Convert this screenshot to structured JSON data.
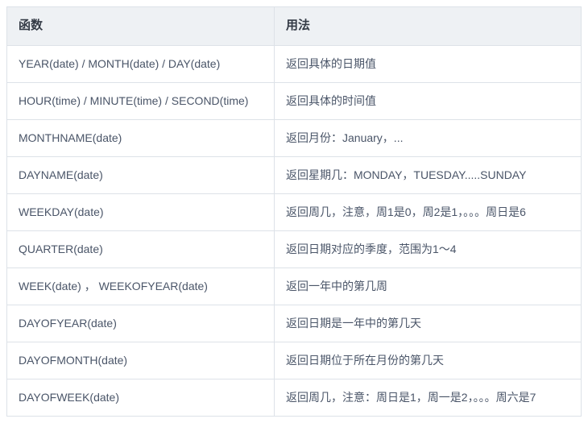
{
  "table": {
    "headers": [
      "函数",
      "用法"
    ],
    "rows": [
      {
        "fn": "YEAR(date) / MONTH(date) / DAY(date)",
        "usage": "返回具体的日期值"
      },
      {
        "fn": "HOUR(time) / MINUTE(time) / SECOND(time)",
        "usage": "返回具体的时间值"
      },
      {
        "fn": "MONTHNAME(date)",
        "usage": "返回月份：January，..."
      },
      {
        "fn": "DAYNAME(date)",
        "usage": "返回星期几：MONDAY，TUESDAY.....SUNDAY"
      },
      {
        "fn": "WEEKDAY(date)",
        "usage": "返回周几，注意，周1是0，周2是1，。。。周日是6"
      },
      {
        "fn": "QUARTER(date)",
        "usage": "返回日期对应的季度，范围为1～4"
      },
      {
        "fn": "WEEK(date) ， WEEKOFYEAR(date)",
        "usage": "返回一年中的第几周"
      },
      {
        "fn": "DAYOFYEAR(date)",
        "usage": "返回日期是一年中的第几天"
      },
      {
        "fn": "DAYOFMONTH(date)",
        "usage": "返回日期位于所在月份的第几天"
      },
      {
        "fn": "DAYOFWEEK(date)",
        "usage": "返回周几，注意：周日是1，周一是2，。。。周六是7"
      }
    ]
  }
}
